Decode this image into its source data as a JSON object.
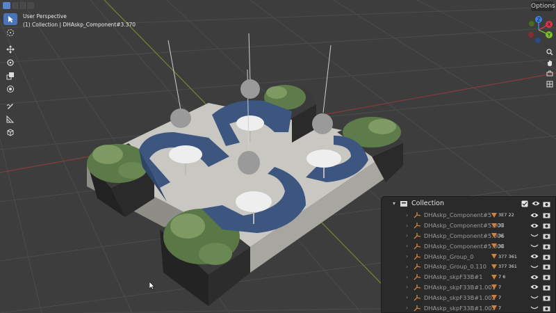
{
  "header": {
    "options_label": "Options"
  },
  "viewport": {
    "view_name": "User Perspective",
    "context_line": "(1) Collection | DHAskp_Component#3.370"
  },
  "gizmo": {
    "x_label": "X",
    "y_label": "Y",
    "z_label": "Z",
    "x_color": "#e0334a",
    "y_color": "#7cbf2a",
    "z_color": "#3f7fe0"
  },
  "outliner": {
    "collection_label": "Collection",
    "items": [
      {
        "label": "DHAskp_Component#5",
        "sub": "3E7 22",
        "visible": true
      },
      {
        "label": "DHAskp_Component#5.003",
        "sub": "3E",
        "visible": true
      },
      {
        "label": "DHAskp_Component#5.006",
        "sub": "3E",
        "visible": false
      },
      {
        "label": "DHAskp_Component#5.008",
        "sub": "3E",
        "visible": false
      },
      {
        "label": "DHAskp_Group_0",
        "sub": "377 361",
        "visible": true
      },
      {
        "label": "DHAskp_Group_0.110",
        "sub": "377 361",
        "visible": false
      },
      {
        "label": "DHAskp_skpF33B#1",
        "sub": "7 6",
        "visible": true
      },
      {
        "label": "DHAskp_skpF33B#1.001",
        "sub": "7",
        "visible": true
      },
      {
        "label": "DHAskp_skpF33B#1.002",
        "sub": "7",
        "visible": false
      },
      {
        "label": "DHAskp_skpF33B#1.003",
        "sub": "7",
        "visible": false
      }
    ]
  },
  "colors": {
    "accent": "#4a74b9",
    "background": "#3d3d3d",
    "grid": "#4a4a4a",
    "axis_x": "#8a3a3a",
    "axis_y": "#6e8a30",
    "object_icon": "#d0813a",
    "seat": "#3d5680",
    "planter": "#2f2f30",
    "platform": "#bdbbb5"
  }
}
